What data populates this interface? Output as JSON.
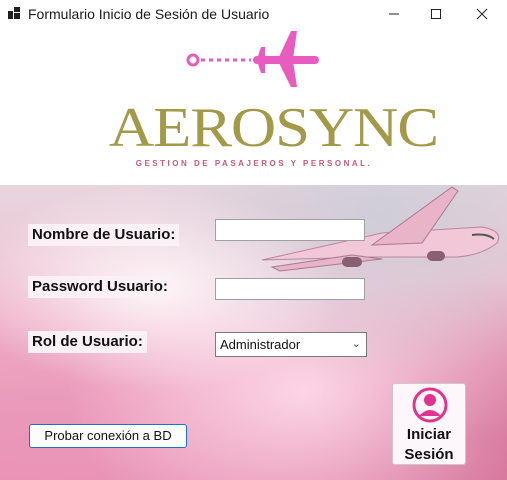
{
  "window": {
    "title": "Formulario Inicio de Sesión de Usuario",
    "icons": [
      "app-icon",
      "minimize-icon",
      "maximize-icon",
      "close-icon"
    ]
  },
  "logo": {
    "name": "AEROSYNC",
    "tagline": "GESTION DE PASAJEROS Y PERSONAL.",
    "colors": {
      "gold": "#a39a49",
      "pink": "#e85bbf"
    }
  },
  "form": {
    "username_label": "Nombre de Usuario:",
    "username_value": "",
    "password_label": "Password Usuario:",
    "password_value": "",
    "role_label": "Rol de Usuario:",
    "role_selected": "Administrador"
  },
  "buttons": {
    "test_connection": "Probar conexión a BD",
    "login_line1": "Iniciar",
    "login_line2": "Sesión"
  }
}
